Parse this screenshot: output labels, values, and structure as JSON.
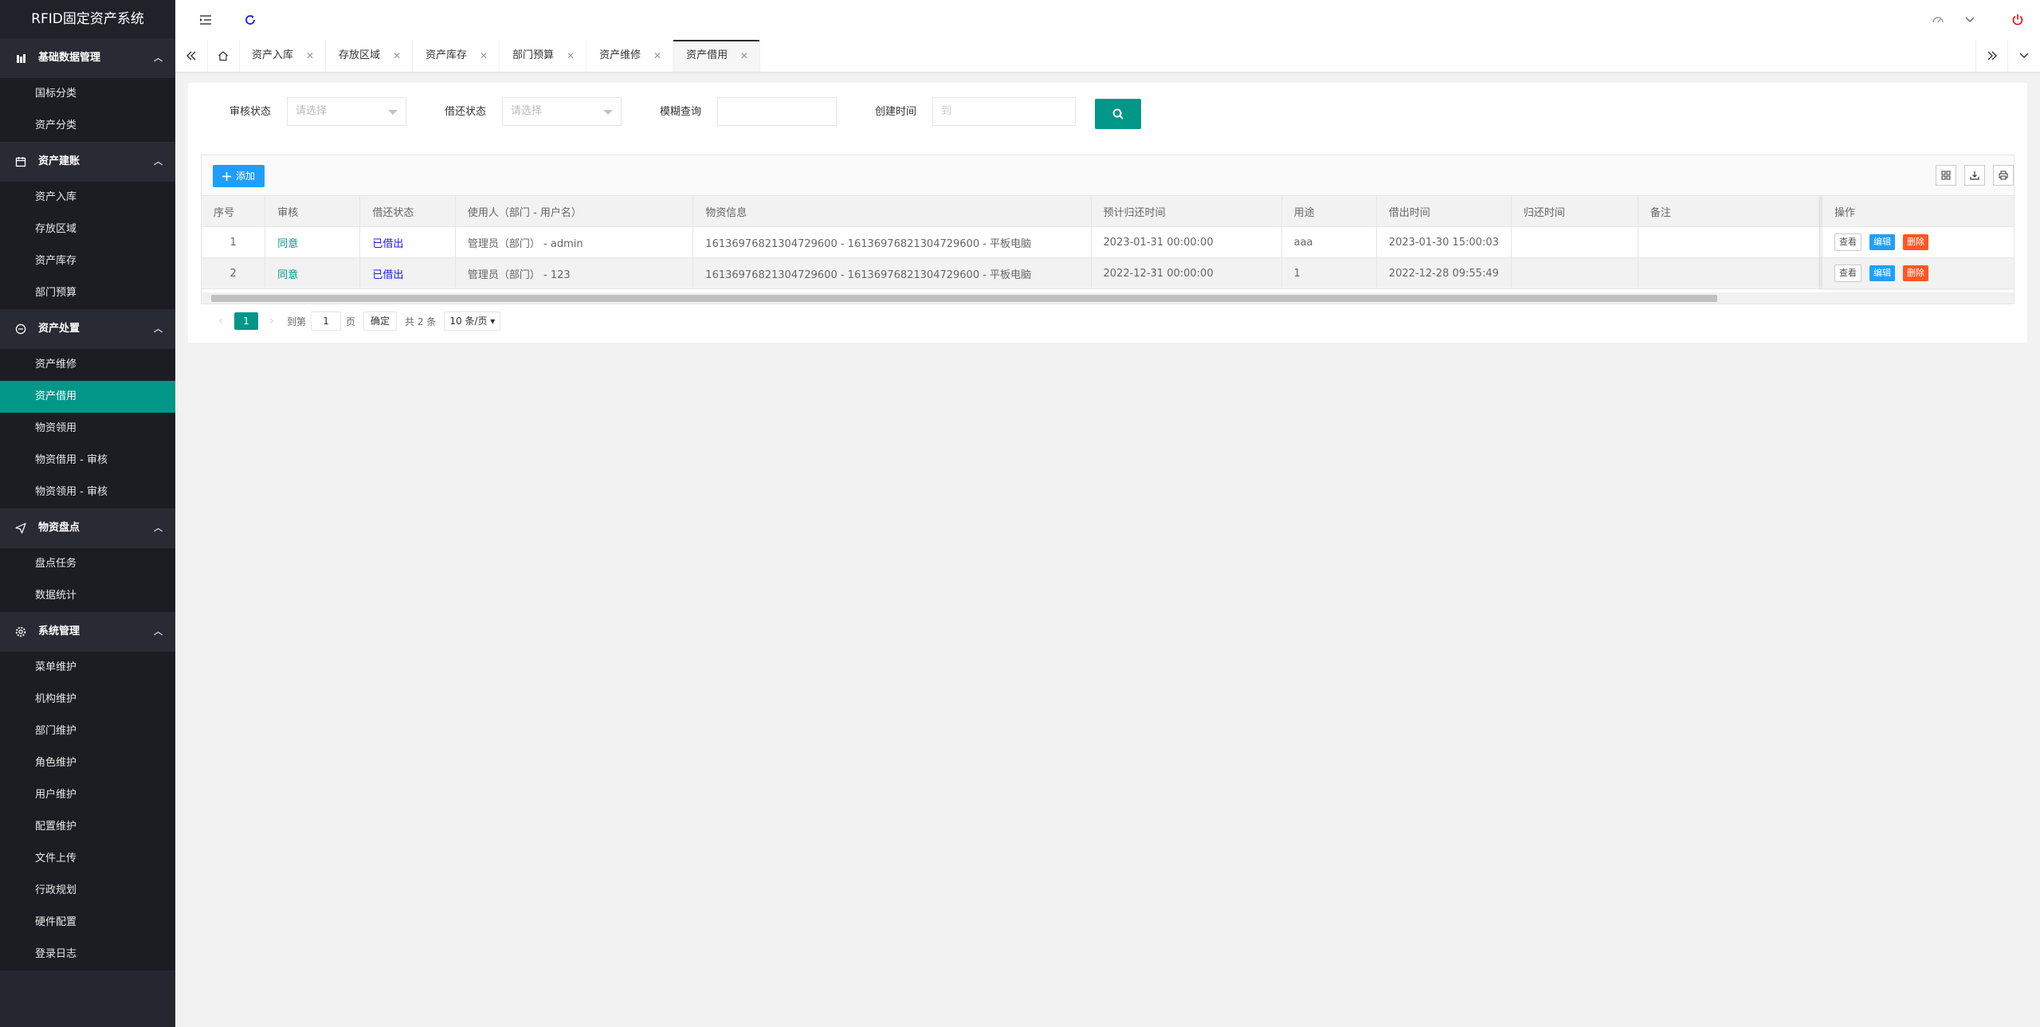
{
  "app_title": "RFID固定资产系统",
  "sidebar": {
    "groups": [
      {
        "title": "基础数据管理",
        "items": [
          "国标分类",
          "资产分类"
        ]
      },
      {
        "title": "资产建账",
        "items": [
          "资产入库",
          "存放区域",
          "资产库存",
          "部门预算"
        ]
      },
      {
        "title": "资产处置",
        "items": [
          "资产维修",
          "资产借用",
          "物资领用",
          "物资借用 - 审核",
          "物资领用 - 审核"
        ]
      },
      {
        "title": "物资盘点",
        "items": [
          "盘点任务",
          "数据统计"
        ]
      },
      {
        "title": "系统管理",
        "items": [
          "菜单维护",
          "机构维护",
          "部门维护",
          "角色维护",
          "用户维护",
          "配置维护",
          "文件上传",
          "行政规划",
          "硬件配置",
          "登录日志"
        ]
      }
    ],
    "active_item": "资产借用"
  },
  "tabs": [
    "资产入库",
    "存放区域",
    "资产库存",
    "部门预算",
    "资产维修",
    "资产借用"
  ],
  "active_tab": "资产借用",
  "filters": {
    "audit_label": "审核状态",
    "audit_placeholder": "请选择",
    "return_label": "借还状态",
    "return_placeholder": "请选择",
    "fuzzy_label": "模糊查询",
    "fuzzy_value": "",
    "created_label": "创建时间",
    "created_placeholder": "到"
  },
  "toolbar": {
    "add_label": "添加"
  },
  "table": {
    "headers": [
      "序号",
      "审核",
      "借还状态",
      "使用人（部门 - 用户名）",
      "物资信息",
      "预计归还时间",
      "用途",
      "借出时间",
      "归还时间",
      "备注",
      "操作"
    ],
    "rows": [
      {
        "no": "1",
        "audit": "同意",
        "status": "已借出",
        "user": "管理员（部门） - admin",
        "info": "1613697682130472960​0 - 1613697682130472960​0 - 平板电脑",
        "expected": "2023-01-31 00:00:00",
        "purpose": "aaa",
        "lent": "2023-01-30 15:00:03",
        "returned": "",
        "remark": ""
      },
      {
        "no": "2",
        "audit": "同意",
        "status": "已借出",
        "user": "管理员（部门） - 123",
        "info": "1613697682130472960​0 - 1613697682130472960​0 - 平板电脑",
        "expected": "2022-12-31 00:00:00",
        "purpose": "1",
        "lent": "2022-12-28 09:55:49",
        "returned": "",
        "remark": ""
      }
    ],
    "ops": {
      "view": "查看",
      "edit": "编辑",
      "delete": "删除"
    }
  },
  "pager": {
    "current": "1",
    "goto_prefix": "到第",
    "goto_value": "1",
    "goto_suffix": "页",
    "confirm": "确定",
    "total": "共 2 条",
    "page_size": "10 条/页"
  },
  "colors": {
    "accent": "#009688",
    "primary": "#1e9fff",
    "danger": "#ff5722",
    "sidebar": "#23262e"
  }
}
